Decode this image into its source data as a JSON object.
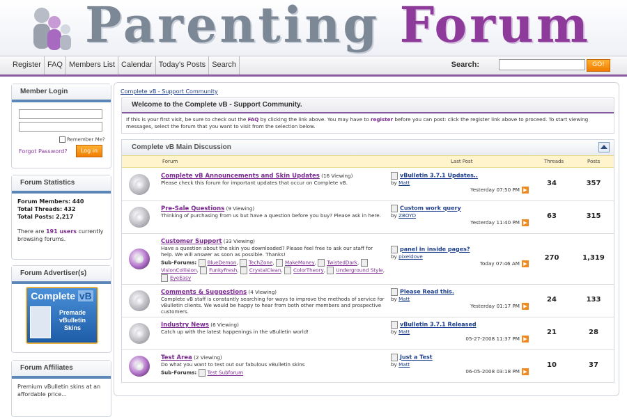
{
  "banner": {
    "title_word1": "Parenting",
    "title_word2": "Forum"
  },
  "navbar": {
    "items": [
      "Register",
      "FAQ",
      "Members List",
      "Calendar",
      "Today's Posts",
      "Search"
    ],
    "search_label": "Search:",
    "search_value": "",
    "go_label": "GO!"
  },
  "login": {
    "header": "Member Login",
    "remember_label": "Remember Me?",
    "forgot_label": "Forgot Password?",
    "login_button": "Log in"
  },
  "stats": {
    "header": "Forum Statistics",
    "members_label": "Forum Members:",
    "members_value": "440",
    "threads_label": "Total Threads:",
    "threads_value": "432",
    "posts_label": "Total Posts:",
    "posts_value": "2,217",
    "online_prefix": "There are",
    "online_users": "191 users",
    "online_suffix": "currently browsing forums."
  },
  "advertiser": {
    "header": "Forum Advertiser(s)",
    "ad_title_a": "Complete",
    "ad_title_b": "vB",
    "ad_line1": "Premade",
    "ad_line2": "vBulletin",
    "ad_line3": "Skins"
  },
  "affiliates": {
    "header": "Forum Affiliates",
    "text": "Premium vBulletin skins at an affordable price..."
  },
  "breadcrumb": "Complete vB - Support Community",
  "welcome": {
    "title": "Welcome to the Complete vB - Support Community.",
    "text1": "If this is your first visit, be sure to check out the",
    "faq_link": "FAQ",
    "text2": "by clicking the link above. You may have to",
    "register_link": "register",
    "text3": "before you can post: click the register link above to proceed. To start viewing messages, select the forum that you want to visit from the selection below."
  },
  "category": {
    "title": "Complete vB Main Discussion",
    "col_forum": "Forum",
    "col_lastpost": "Last Post",
    "col_threads": "Threads",
    "col_posts": "Posts"
  },
  "forums": [
    {
      "title": "Complete vB Announcements and Skin Updates",
      "viewing": "(16 Viewing)",
      "desc": "Please check this forum for important updates that occur on Complete vB.",
      "last_title": "vBulletin 3.7.1 Updates..",
      "last_by": "Matt",
      "last_when": "Yesterday 07:50 PM",
      "threads": "34",
      "posts": "357",
      "new": false,
      "subforums": []
    },
    {
      "title": "Pre-Sale Questions",
      "viewing": "(9 Viewing)",
      "desc": "Thinking of purchasing from us but have a question before you buy? Please ask in here.",
      "last_title": "Custom work query",
      "last_by": "ZBOYD",
      "last_when": "Yesterday 11:40 PM",
      "threads": "63",
      "posts": "315",
      "new": false,
      "subforums": []
    },
    {
      "title": "Customer Support",
      "viewing": "(33 Viewing)",
      "desc": "Have a question about the skin you downloaded? Please feel free to ask our staff for help. We will answer as soon as possible. Thanks!",
      "last_title": "panel in inside pages?",
      "last_by": "pixeldove",
      "last_when": "Today 07:46 AM",
      "threads": "270",
      "posts": "1,319",
      "new": true,
      "subforums": [
        "BlueDemon",
        "TechZone",
        "MakeMoney",
        "TwistedDark",
        "VisionCollision",
        "FunkyFresh",
        "CrystalClean",
        "ColorTheory",
        "Underground Style",
        "EyeEasy"
      ]
    },
    {
      "title": "Comments & Suggestions",
      "viewing": "(4 Viewing)",
      "desc": "Complete vB staff is constantly searching for ways to improve the methods of service for vBulletin clients. We would be happy to hear from both other members and prospective customers.",
      "last_title": "Please Read this.",
      "last_by": "Matt",
      "last_when": "Yesterday 01:17 PM",
      "threads": "24",
      "posts": "133",
      "new": false,
      "subforums": []
    },
    {
      "title": "Industry News",
      "viewing": "(6 Viewing)",
      "desc": "Catch up with the latest happenings in the vBulletin world!",
      "last_title": "vBulletin 3.7.1 Released",
      "last_by": "Matt",
      "last_when": "05-27-2008 11:37 PM",
      "threads": "21",
      "posts": "28",
      "new": false,
      "subforums": []
    },
    {
      "title": "Test Area",
      "viewing": "(2 Viewing)",
      "desc": "Do what you want to test out our fabulous vBulletin skins",
      "last_title": "Just a Test",
      "last_by": "Matt",
      "last_when": "06-05-2008 03:18 PM",
      "threads": "10",
      "posts": "37",
      "new": true,
      "subforums": [
        "Test Subforum"
      ]
    }
  ],
  "labels": {
    "sub_forums": "Sub-Forums:",
    "by": "by"
  },
  "colors": {
    "accent_purple": "#8d3a9a",
    "link_blue": "#1a3c8c",
    "sidebar_rule": "#5b86b8",
    "button_orange": "#f07d00",
    "column_header": "#fff4cc"
  }
}
